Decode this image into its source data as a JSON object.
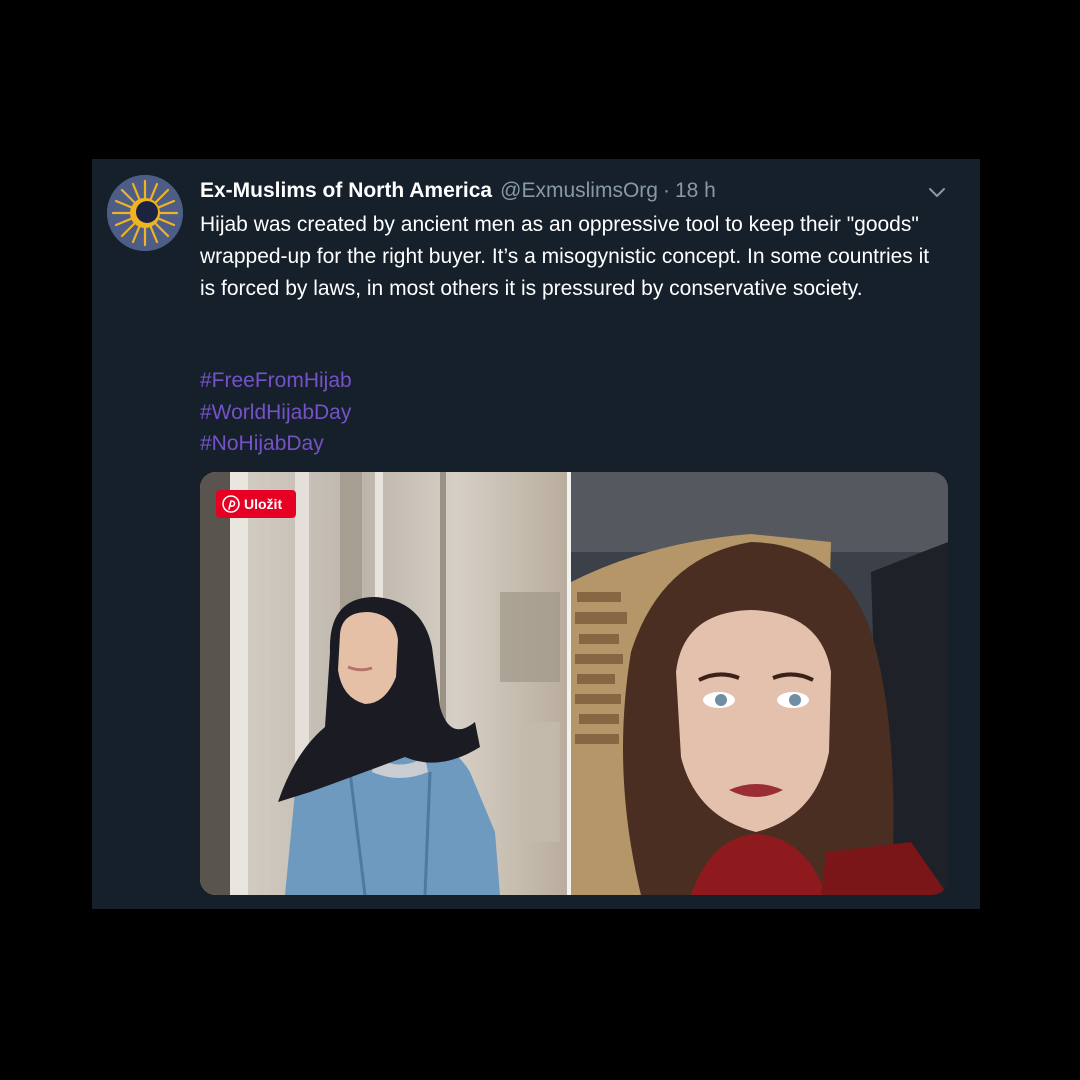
{
  "tweet": {
    "author_name": "Ex-Muslims of North America",
    "handle": "@ExmuslimsOrg",
    "separator": "·",
    "time": "18 h",
    "text": "Hijab was created by ancient men as an oppressive tool to keep their \"goods\" wrapped-up for the right buyer. It’s a misogynistic concept. In some countries it is forced by laws, in most others it is pressured by conservative society.",
    "hashtags": [
      "#FreeFromHijab",
      "#WorldHijabDay",
      "#NoHijabDay"
    ]
  },
  "media": {
    "save_label": "Uložit",
    "left_photo": "woman-in-black-hijab-and-denim-jacket",
    "right_photo": "woman-with-long-brown-hair-selfie"
  },
  "icons": {
    "avatar": "sun-logo-icon",
    "menu": "chevron-down-icon",
    "save": "pinterest-icon",
    "expand": "expand-icon"
  },
  "colors": {
    "background": "#000000",
    "card": "#15202b",
    "text": "#ffffff",
    "muted": "#8899a6",
    "hashtag": "#7552c8",
    "pinterest": "#e60023"
  }
}
